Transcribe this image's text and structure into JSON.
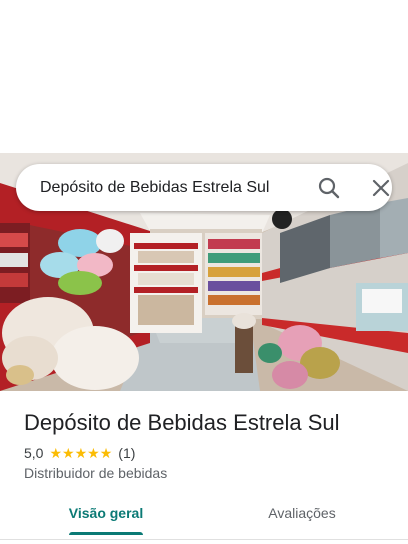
{
  "search": {
    "query": "Depósito de Bebidas Estrela Sul",
    "search_icon": "search-icon",
    "close_icon": "close-icon"
  },
  "place": {
    "name": "Depósito de Bebidas Estrela Sul",
    "rating": "5,0",
    "stars": 5,
    "review_count": "(1)",
    "category": "Distribuidor de bebidas"
  },
  "tabs": [
    {
      "label": "Visão geral",
      "active": true
    },
    {
      "label": "Avaliações",
      "active": false
    }
  ],
  "colors": {
    "accent": "#0b7a75",
    "star": "#fbbc04",
    "text_primary": "#202124",
    "text_secondary": "#5f6368"
  }
}
